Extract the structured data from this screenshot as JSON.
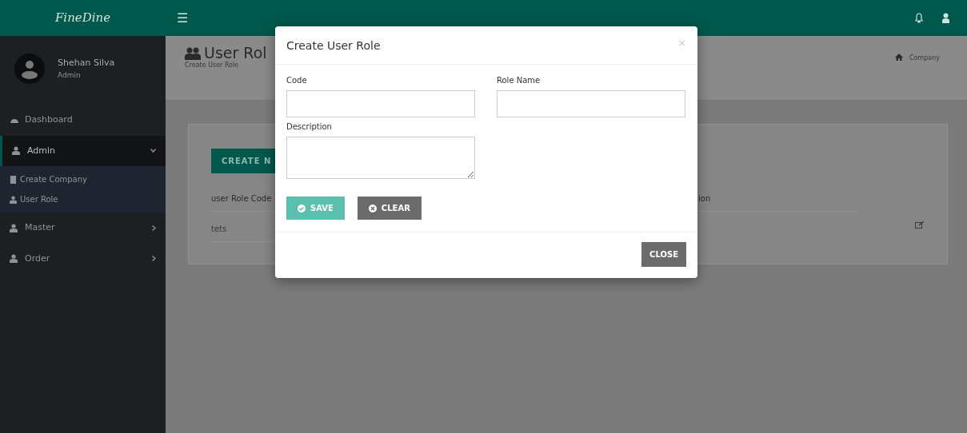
{
  "topbar": {
    "logo": "FineDine",
    "menu_glyph": "☰"
  },
  "user": {
    "name": "Shehan Silva",
    "role": "Admin"
  },
  "sidebar": {
    "items": [
      {
        "label": "Dashboard",
        "kind": "dashboard",
        "selected": false
      },
      {
        "label": "Admin",
        "kind": "user",
        "selected": true,
        "expanded": true,
        "children": [
          {
            "label": "Create Company",
            "kind": "building"
          },
          {
            "label": "User Role",
            "kind": "user"
          }
        ]
      },
      {
        "label": "Master",
        "kind": "user",
        "selected": false,
        "expanded": false
      },
      {
        "label": "Order",
        "kind": "user",
        "selected": false,
        "expanded": false
      }
    ]
  },
  "page_header": {
    "title": "User Rol",
    "subtitle": "Create User Role",
    "breadcrumb": [
      "Company"
    ]
  },
  "content": {
    "create_button": "CREATE N",
    "table": {
      "columns": [
        "user Role Code",
        "ion"
      ],
      "rows": [
        [
          "tets"
        ]
      ]
    }
  },
  "modal": {
    "title": "Create User Role",
    "close": "×",
    "fields": [
      {
        "label": "Code",
        "kind": "input"
      },
      {
        "label": "Role Name",
        "kind": "input"
      },
      {
        "label": "Description",
        "kind": "textarea"
      }
    ],
    "buttons": [
      {
        "label": "SAVE",
        "kind": "save"
      },
      {
        "label": "CLEAR",
        "kind": "clear"
      }
    ],
    "footer_button": "CLOSE"
  }
}
